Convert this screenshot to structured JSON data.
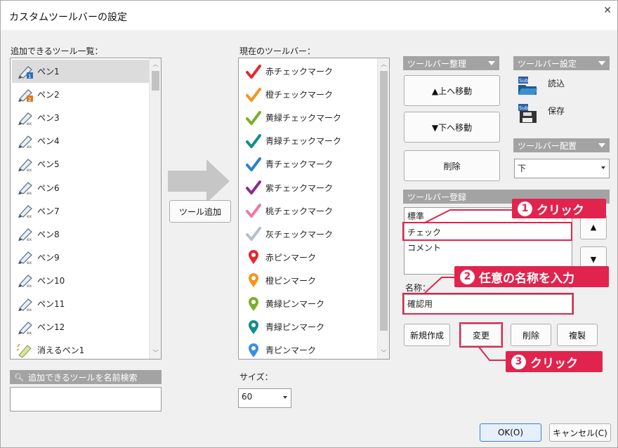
{
  "window": {
    "title": "カスタムツールバーの設定",
    "close_icon": "close-icon"
  },
  "available": {
    "label": "追加できるツール一覧：",
    "items": [
      "ペン1",
      "ペン2",
      "ペン3",
      "ペン4",
      "ペン5",
      "ペン6",
      "ペン7",
      "ペン8",
      "ペン9",
      "ペン10",
      "ペン11",
      "ペン12",
      "消えるペン1"
    ],
    "search_label": "追加できるツールを名前検索",
    "search_value": ""
  },
  "add_button": "ツール追加",
  "current": {
    "label": "現在のツールバー：",
    "items": [
      {
        "label": "赤チェックマーク",
        "kind": "check",
        "color": "#e8262c"
      },
      {
        "label": "橙チェックマーク",
        "kind": "check",
        "color": "#f39422"
      },
      {
        "label": "黄緑チェックマーク",
        "kind": "check",
        "color": "#78b02c"
      },
      {
        "label": "青緑チェックマーク",
        "kind": "check",
        "color": "#0f8f8a"
      },
      {
        "label": "青チェックマーク",
        "kind": "check",
        "color": "#2b7fd2"
      },
      {
        "label": "紫チェックマーク",
        "kind": "check",
        "color": "#8a2a8f"
      },
      {
        "label": "桃チェックマーク",
        "kind": "check",
        "color": "#ee7aa6"
      },
      {
        "label": "灰チェックマーク",
        "kind": "check",
        "color": "#b5c0cc"
      },
      {
        "label": "赤ピンマーク",
        "kind": "pin",
        "color": "#e8262c"
      },
      {
        "label": "橙ピンマーク",
        "kind": "pin",
        "color": "#f39422"
      },
      {
        "label": "黄緑ピンマーク",
        "kind": "pin",
        "color": "#78b02c"
      },
      {
        "label": "青緑ピンマーク",
        "kind": "pin",
        "color": "#0f8f8a"
      },
      {
        "label": "青ピンマーク",
        "kind": "pin",
        "color": "#3a8fe0"
      }
    ],
    "size_label": "サイズ：",
    "size_value": "60"
  },
  "arrange": {
    "header": "ツールバー整理",
    "up": "▲上へ移動",
    "down": "▼下へ移動",
    "delete": "削除"
  },
  "settings": {
    "header": "ツールバー設定",
    "load": "読込",
    "save": "保存",
    "placement_header": "ツールバー配置",
    "placement_value": "下"
  },
  "register": {
    "header": "ツールバー登録",
    "items": [
      "標準",
      "チェック",
      "コメント"
    ],
    "name_label": "名称：",
    "name_value": "確認用",
    "buttons": {
      "new": "新規作成",
      "change": "変更",
      "delete": "削除",
      "copy": "複製"
    }
  },
  "annotations": {
    "step1": {
      "num": "1",
      "text": "クリック"
    },
    "step2": {
      "num": "2",
      "text": "任意の名称を入力"
    },
    "step3": {
      "num": "3",
      "text": "クリック"
    }
  },
  "footer": {
    "ok": "OK(O)",
    "cancel": "キャンセル(C)"
  },
  "colors": {
    "accent": "#e0244e",
    "section_header": "#a3a3a3"
  }
}
